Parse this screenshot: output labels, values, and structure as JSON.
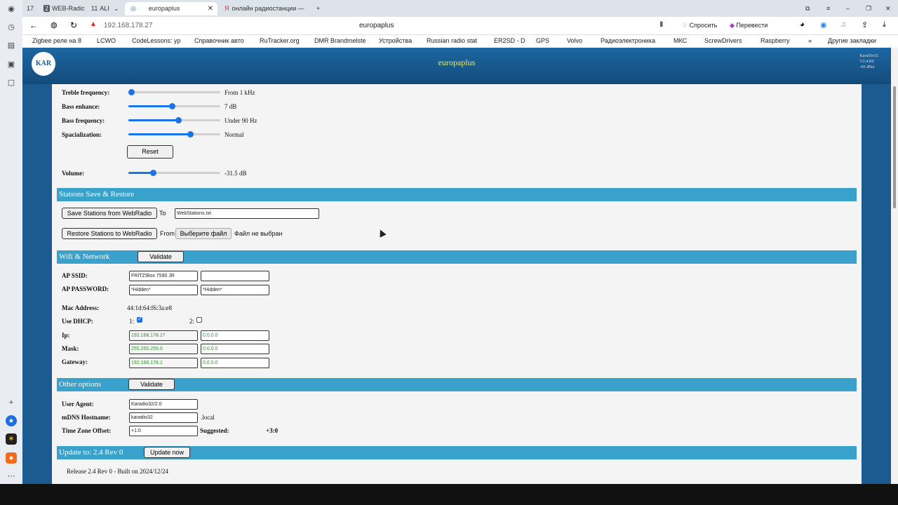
{
  "browser": {
    "tabs": [
      {
        "label": "17",
        "active": false
      },
      {
        "label": "WEB-Radio",
        "active": false
      },
      {
        "label": "ALI",
        "active": false
      },
      {
        "label": "europaplus",
        "active": true
      },
      {
        "label": "онлайн радиостанции —",
        "active": false
      }
    ],
    "tab_counts": {
      "web_radio": "2",
      "ali": "11"
    },
    "address": "192.168.178.27",
    "page_title": "europaplus",
    "ask_label": "Спросить",
    "translate_label": "Перевести",
    "bookmarks": [
      "Zigbee реле на 8",
      "LCWO",
      "CodeLessons: ур",
      "Справочник авто",
      "RuTracker.org",
      "DMR Brandmelste",
      "Устройства",
      "Russian radio stat",
      "ER2SD - D",
      "GPS",
      "Volvo",
      "Радиоэлектроника",
      "МКС",
      "ScrewDrivers",
      "Raspberry"
    ],
    "other_bookmarks": "Другие закладки",
    "more": "»"
  },
  "header": {
    "logo": "KAR",
    "title": "europaplus",
    "info": [
      "KaraDio32",
      "V2.4 R0",
      "-60 dBm"
    ]
  },
  "sound": {
    "treble_freq": {
      "label": "Treble frequency:",
      "value": "From 1 kHz",
      "level": 0.03
    },
    "bass_enhance": {
      "label": "Bass enhance:",
      "value": "7 dB",
      "level": 0.47
    },
    "bass_freq": {
      "label": "Bass frequency:",
      "value": "Under 90 Hz",
      "level": 0.54
    },
    "spatial": {
      "label": "Spacialization:",
      "value": "Normal",
      "level": 0.67
    },
    "reset": "Reset",
    "volume": {
      "label": "Volume:",
      "value": "-31.5 dB",
      "level": 0.27
    }
  },
  "stations": {
    "title": "Stations Save & Restore",
    "save_btn": "Save Stations from WebRadio",
    "to": "To",
    "filename": "WebStations.txt",
    "restore_btn": "Restore Stations to WebRadio",
    "from": "From",
    "choose_file": "Выберите файл",
    "no_file": "Файл не выбран"
  },
  "wifi": {
    "title": "Wifi & Network",
    "validate": "Validate",
    "ssid_label": "AP SSID:",
    "ssid1": "FRITZ!Box 7590 JR",
    "ssid2": "",
    "pass_label": "AP PASSWORD:",
    "pass1": "*Hidden*",
    "pass2": "*Hidden*",
    "mac_label": "Mac Address:",
    "mac": "44:1d:64:f6:3a:e8",
    "dhcp_label": "Use DHCP:",
    "dhcp1_label": "1:",
    "dhcp2_label": "2:",
    "ip_label": "Ip:",
    "ip1": "192.168.178.27",
    "ip2": "0.0.0.0",
    "mask_label": "Mask:",
    "mask1": "255.255.255.0",
    "mask2": "0.0.0.0",
    "gw_label": "Gateway:",
    "gw1": "192.168.178.1",
    "gw2": "0.0.0.0"
  },
  "other": {
    "title": "Other options",
    "validate": "Validate",
    "ua_label": "User Agent:",
    "ua": "Karadio32/2.0",
    "mdns_label": "mDNS Hostname:",
    "mdns": "karadio32",
    "mdns_suffix": ".local",
    "tz_label": "Time Zone Offset:",
    "tz": "+1.0",
    "suggested_label": "Suggested:",
    "suggested": "+3:0"
  },
  "update": {
    "title": "Update to: 2.4 Rev 0",
    "button": "Update now",
    "release": "Release 2.4 Rev 0 - Built on 2024/12/24"
  }
}
